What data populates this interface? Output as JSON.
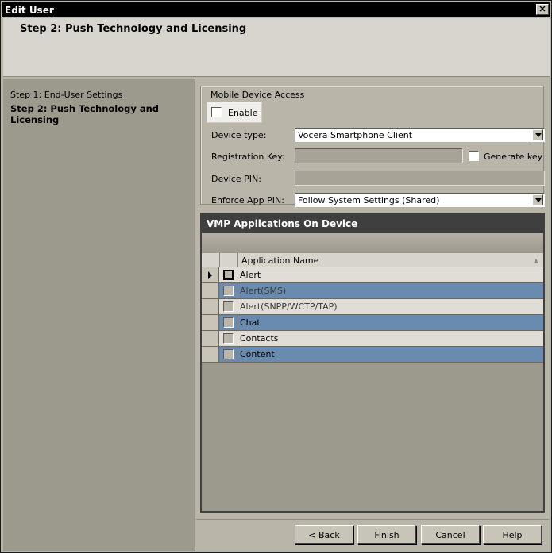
{
  "window": {
    "title": "Edit User",
    "close_glyph": "✕"
  },
  "header": {
    "title": "Step 2: Push Technology and Licensing"
  },
  "steps": [
    {
      "label": "Step 1: End-User Settings",
      "current": false
    },
    {
      "label": "Step 2: Push Technology and Licensing",
      "current": true
    }
  ],
  "mobile_access": {
    "legend": "Mobile Device Access",
    "enable_label": "Enable",
    "enable_checked": false,
    "device_type_label": "Device type:",
    "device_type_value": "Vocera Smartphone Client",
    "registration_key_label": "Registration Key:",
    "registration_key_value": "",
    "generate_key_label": "Generate  key",
    "generate_key_checked": false,
    "device_pin_label": "Device PIN:",
    "device_pin_value": "",
    "enforce_pin_label": "Enforce App PIN:",
    "enforce_pin_value": "Follow System Settings (Shared)"
  },
  "grid": {
    "title": "VMP Applications On Device",
    "column_name": "Application Name",
    "rows": [
      {
        "name": "Alert",
        "checked": false,
        "current": true
      },
      {
        "name": "Alert(SMS)",
        "checked": false,
        "current": false
      },
      {
        "name": "Alert(SNPP/WCTP/TAP)",
        "checked": false,
        "current": false
      },
      {
        "name": "Chat",
        "checked": false,
        "current": false
      },
      {
        "name": "Contacts",
        "checked": false,
        "current": false
      },
      {
        "name": "Content",
        "checked": false,
        "current": false
      }
    ]
  },
  "buttons": {
    "back": "< Back",
    "finish": "Finish",
    "cancel": "Cancel",
    "help": "Help"
  },
  "colors": {
    "title_bar": "#000000",
    "row_alt": "#6a8bb0",
    "grid_header": "#3f3f3f"
  }
}
